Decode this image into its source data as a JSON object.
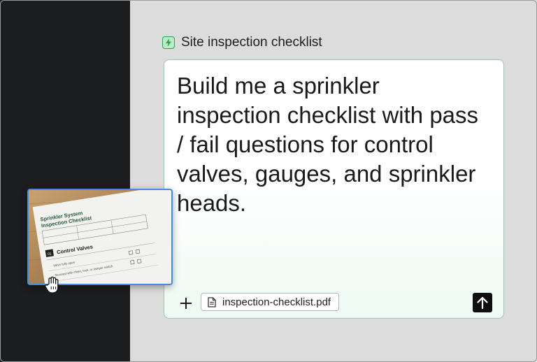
{
  "header": {
    "title": "Site inspection checklist",
    "icon": "lightning-bolt-icon",
    "icon_color": "#2f9e55"
  },
  "prompt": {
    "text": "Build me a sprinkler inspection checklist with pass / fail questions for control valves, gauges, and sprinkler heads."
  },
  "composer": {
    "add_icon": "plus-icon",
    "attachment": {
      "name": "inspection-checklist.pdf",
      "icon": "document-icon"
    },
    "send_icon": "arrow-up-icon"
  },
  "dragged_image": {
    "doc_title_line1": "Sprinkler System",
    "doc_title_line2": "Inspection Checklist",
    "section_number": "01",
    "section_title": "Control Valves",
    "item_1": "Valve fully open",
    "item_2": "Secured with chain, lock, or tamper switch",
    "cursor_icon": "grab-hand-cursor-icon"
  },
  "colors": {
    "sidebar": "#1c1d1f",
    "background": "#dcdcdc",
    "card_border": "#9fc9ad",
    "accent_green": "#2f9e55",
    "drag_outline": "#4a8ad6"
  }
}
